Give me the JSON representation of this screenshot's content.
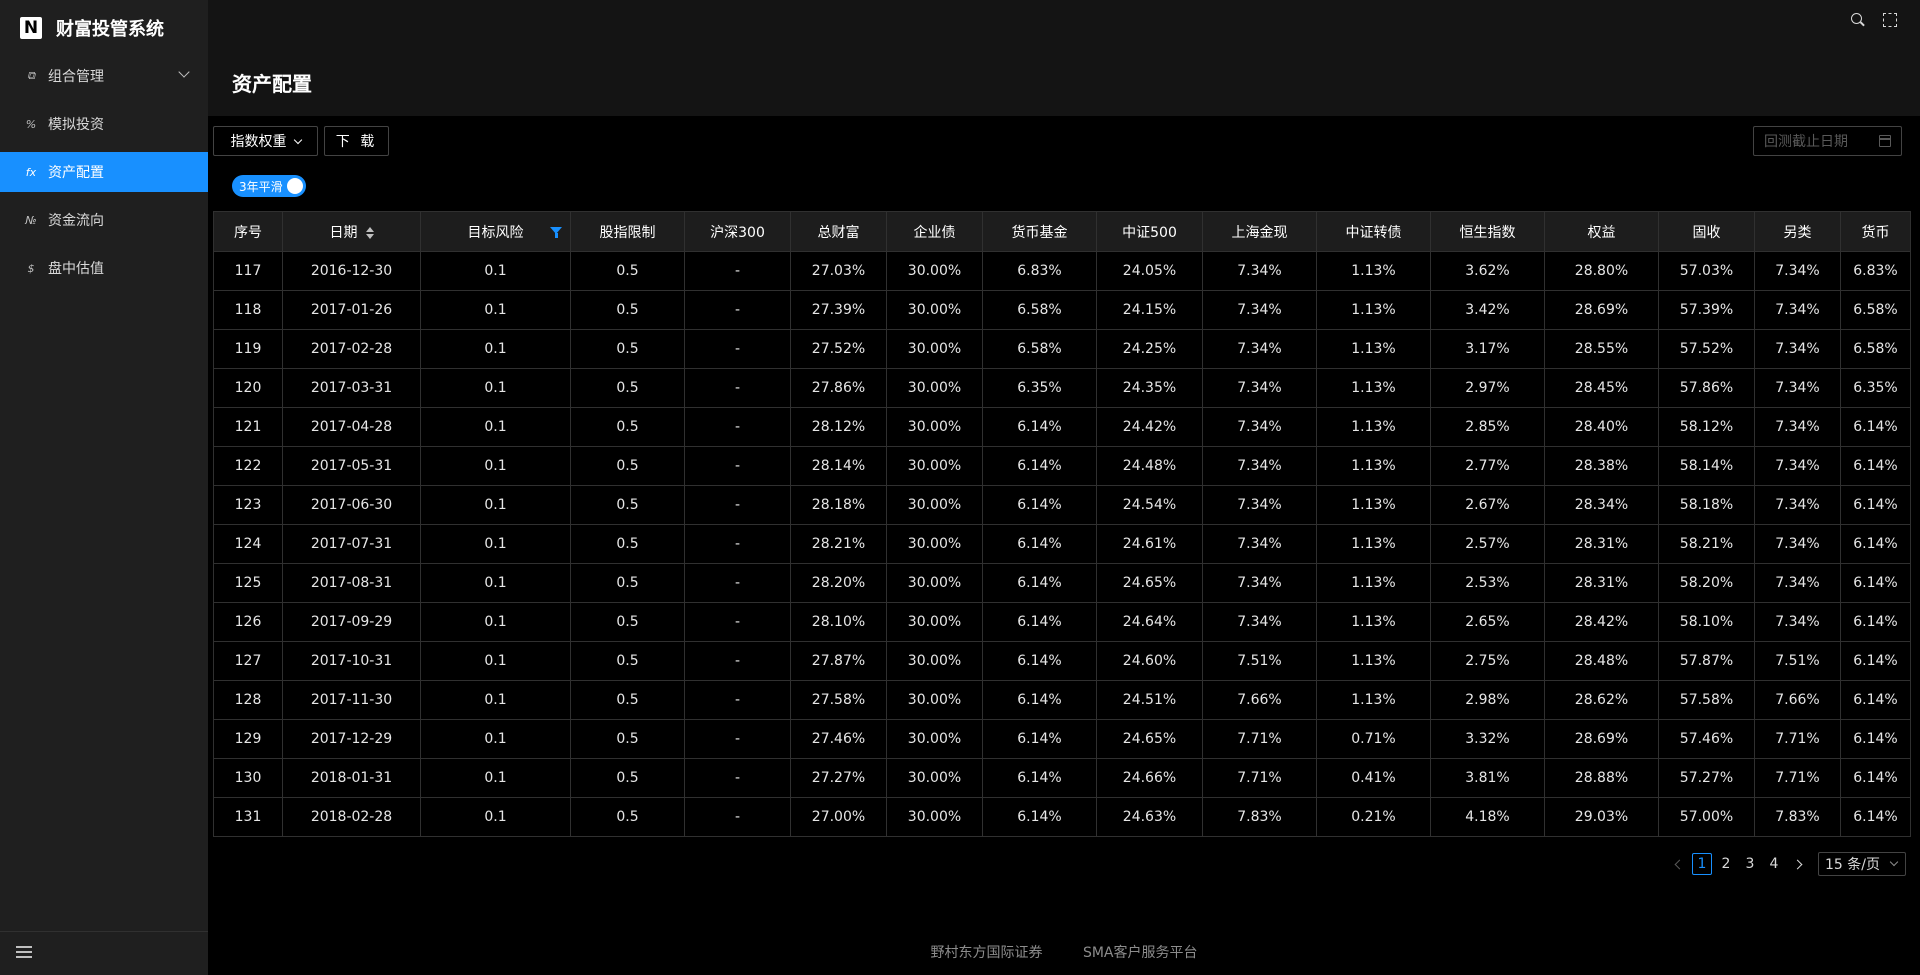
{
  "brand": {
    "logo": "N",
    "title": "财富投管系统"
  },
  "sidebar": {
    "items": [
      {
        "icon": "⧉",
        "label": "组合管理",
        "active": false,
        "expandable": true
      },
      {
        "icon": "%",
        "label": "模拟投资",
        "active": false
      },
      {
        "icon": "fx",
        "label": "资产配置",
        "active": true
      },
      {
        "icon": "№",
        "label": "资金流向",
        "active": false
      },
      {
        "icon": "$",
        "label": "盘中估值",
        "active": false
      }
    ]
  },
  "page": {
    "title": "资产配置"
  },
  "toolbar": {
    "index_weight_label": "指数权重",
    "download_label": "下 载",
    "date_placeholder": "回测截止日期",
    "smooth_toggle_label": "3年平滑"
  },
  "table": {
    "columns": [
      "序号",
      "日期",
      "目标风险",
      "股指限制",
      "沪深300",
      "总财富",
      "企业债",
      "货币基金",
      "中证500",
      "上海金现",
      "中证转债",
      "恒生指数",
      "权益",
      "固收",
      "另类",
      "货币"
    ],
    "rows": [
      [
        "117",
        "2016-12-30",
        "0.1",
        "0.5",
        "-",
        "27.03%",
        "30.00%",
        "6.83%",
        "24.05%",
        "7.34%",
        "1.13%",
        "3.62%",
        "28.80%",
        "57.03%",
        "7.34%",
        "6.83%"
      ],
      [
        "118",
        "2017-01-26",
        "0.1",
        "0.5",
        "-",
        "27.39%",
        "30.00%",
        "6.58%",
        "24.15%",
        "7.34%",
        "1.13%",
        "3.42%",
        "28.69%",
        "57.39%",
        "7.34%",
        "6.58%"
      ],
      [
        "119",
        "2017-02-28",
        "0.1",
        "0.5",
        "-",
        "27.52%",
        "30.00%",
        "6.58%",
        "24.25%",
        "7.34%",
        "1.13%",
        "3.17%",
        "28.55%",
        "57.52%",
        "7.34%",
        "6.58%"
      ],
      [
        "120",
        "2017-03-31",
        "0.1",
        "0.5",
        "-",
        "27.86%",
        "30.00%",
        "6.35%",
        "24.35%",
        "7.34%",
        "1.13%",
        "2.97%",
        "28.45%",
        "57.86%",
        "7.34%",
        "6.35%"
      ],
      [
        "121",
        "2017-04-28",
        "0.1",
        "0.5",
        "-",
        "28.12%",
        "30.00%",
        "6.14%",
        "24.42%",
        "7.34%",
        "1.13%",
        "2.85%",
        "28.40%",
        "58.12%",
        "7.34%",
        "6.14%"
      ],
      [
        "122",
        "2017-05-31",
        "0.1",
        "0.5",
        "-",
        "28.14%",
        "30.00%",
        "6.14%",
        "24.48%",
        "7.34%",
        "1.13%",
        "2.77%",
        "28.38%",
        "58.14%",
        "7.34%",
        "6.14%"
      ],
      [
        "123",
        "2017-06-30",
        "0.1",
        "0.5",
        "-",
        "28.18%",
        "30.00%",
        "6.14%",
        "24.54%",
        "7.34%",
        "1.13%",
        "2.67%",
        "28.34%",
        "58.18%",
        "7.34%",
        "6.14%"
      ],
      [
        "124",
        "2017-07-31",
        "0.1",
        "0.5",
        "-",
        "28.21%",
        "30.00%",
        "6.14%",
        "24.61%",
        "7.34%",
        "1.13%",
        "2.57%",
        "28.31%",
        "58.21%",
        "7.34%",
        "6.14%"
      ],
      [
        "125",
        "2017-08-31",
        "0.1",
        "0.5",
        "-",
        "28.20%",
        "30.00%",
        "6.14%",
        "24.65%",
        "7.34%",
        "1.13%",
        "2.53%",
        "28.31%",
        "58.20%",
        "7.34%",
        "6.14%"
      ],
      [
        "126",
        "2017-09-29",
        "0.1",
        "0.5",
        "-",
        "28.10%",
        "30.00%",
        "6.14%",
        "24.64%",
        "7.34%",
        "1.13%",
        "2.65%",
        "28.42%",
        "58.10%",
        "7.34%",
        "6.14%"
      ],
      [
        "127",
        "2017-10-31",
        "0.1",
        "0.5",
        "-",
        "27.87%",
        "30.00%",
        "6.14%",
        "24.60%",
        "7.51%",
        "1.13%",
        "2.75%",
        "28.48%",
        "57.87%",
        "7.51%",
        "6.14%"
      ],
      [
        "128",
        "2017-11-30",
        "0.1",
        "0.5",
        "-",
        "27.58%",
        "30.00%",
        "6.14%",
        "24.51%",
        "7.66%",
        "1.13%",
        "2.98%",
        "28.62%",
        "57.58%",
        "7.66%",
        "6.14%"
      ],
      [
        "129",
        "2017-12-29",
        "0.1",
        "0.5",
        "-",
        "27.46%",
        "30.00%",
        "6.14%",
        "24.65%",
        "7.71%",
        "0.71%",
        "3.32%",
        "28.69%",
        "57.46%",
        "7.71%",
        "6.14%"
      ],
      [
        "130",
        "2018-01-31",
        "0.1",
        "0.5",
        "-",
        "27.27%",
        "30.00%",
        "6.14%",
        "24.66%",
        "7.71%",
        "0.41%",
        "3.81%",
        "28.88%",
        "57.27%",
        "7.71%",
        "6.14%"
      ],
      [
        "131",
        "2018-02-28",
        "0.1",
        "0.5",
        "-",
        "27.00%",
        "30.00%",
        "6.14%",
        "24.63%",
        "7.83%",
        "0.21%",
        "4.18%",
        "29.03%",
        "57.00%",
        "7.83%",
        "6.14%"
      ]
    ]
  },
  "pagination": {
    "pages": [
      "1",
      "2",
      "3",
      "4"
    ],
    "current": "1",
    "page_size": "15 条/页"
  },
  "footer": {
    "left": "野村东方国际证券",
    "right": "SMA客户服务平台"
  },
  "colors": {
    "accent": "#1890ff",
    "sidebar_bg": "#1f1f1f",
    "header_bg": "#141414",
    "content_bg": "#000000"
  }
}
